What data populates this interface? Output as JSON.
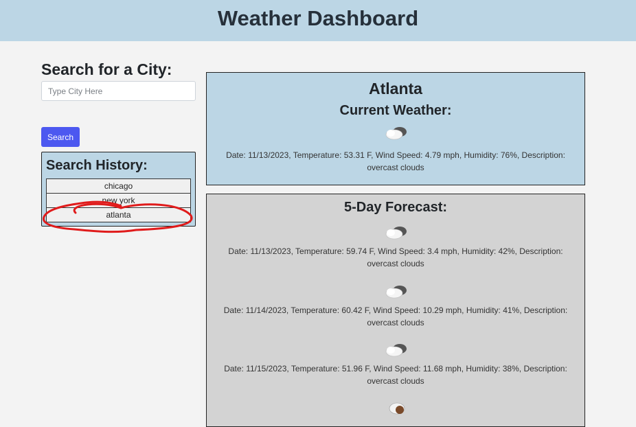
{
  "header": {
    "title": "Weather Dashboard"
  },
  "search": {
    "title": "Search for a City:",
    "placeholder": "Type City Here",
    "value": "",
    "button_label": "Search"
  },
  "history": {
    "title": "Search History:",
    "items": [
      {
        "label": "chicago"
      },
      {
        "label": "new york"
      },
      {
        "label": "atlanta"
      }
    ]
  },
  "current": {
    "city": "Atlanta",
    "subtitle": "Current Weather:",
    "icon": "overcast-clouds-icon",
    "info": "Date: 11/13/2023, Temperature: 53.31 F, Wind Speed: 4.79 mph, Humidity: 76%, Description: overcast clouds"
  },
  "forecast": {
    "title": "5-Day Forecast:",
    "days": [
      {
        "icon": "overcast-clouds-icon",
        "info": "Date: 11/13/2023, Temperature: 59.74 F, Wind Speed: 3.4 mph, Humidity: 42%, Description: overcast clouds"
      },
      {
        "icon": "overcast-clouds-icon",
        "info": "Date: 11/14/2023, Temperature: 60.42 F, Wind Speed: 10.29 mph, Humidity: 41%, Description: overcast clouds"
      },
      {
        "icon": "overcast-clouds-icon",
        "info": "Date: 11/15/2023, Temperature: 51.96 F, Wind Speed: 11.68 mph, Humidity: 38%, Description: overcast clouds"
      },
      {
        "icon": "rain-cloud-icon",
        "info": ""
      }
    ]
  },
  "colors": {
    "header_bg": "#bcd6e5",
    "search_button": "#4c58f0",
    "forecast_bg": "#d3d3d3",
    "annotation": "#e01b1b"
  }
}
